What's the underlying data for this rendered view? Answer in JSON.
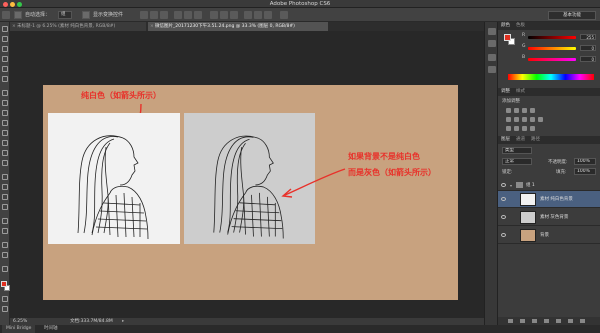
{
  "window": {
    "app_title": "Adobe Photoshop CS6",
    "workspace": "基本功能"
  },
  "options_bar": {
    "auto_select": "自动选择：",
    "auto_select_value": "组",
    "show_transform": "显示变换控件"
  },
  "tabs": [
    {
      "label": "未标题-1 @ 6.25% (素材 纯白色背景, RGB/8#)",
      "active": false
    },
    {
      "label": "微信图片_20171230下午3.51.24.png @ 33.3% (图层 0, RGB/8#)",
      "active": true
    }
  ],
  "canvas": {
    "annotation_top": "纯白色（如箭头所示）",
    "annotation_right_line1": "如果背景不是纯白色",
    "annotation_right_line2": "而是灰色（如箭头所示）",
    "doc_bg": "#c8a27f",
    "annotation_color": "#e8312a"
  },
  "status": {
    "zoom": "6.25%",
    "doc_size": "文档:333.7M/84.8M"
  },
  "mini_bridge": {
    "tab1": "Mini Bridge",
    "tab2": "时间轴"
  },
  "color_panel": {
    "tab1": "颜色",
    "tab2": "色板",
    "r_label": "R",
    "r_value": "255",
    "g_label": "G",
    "g_value": "0",
    "b_label": "B",
    "b_value": "0"
  },
  "adjust_panel": {
    "tab1": "调整",
    "tab2": "样式",
    "title": "添加调整"
  },
  "layers_panel": {
    "tab1": "图层",
    "tab2": "通道",
    "tab3": "路径",
    "kind": "类型",
    "blend_mode": "正常",
    "opacity_label": "不透明度:",
    "opacity": "100%",
    "lock_label": "锁定:",
    "fill_label": "填充:",
    "fill": "100%",
    "layers": [
      {
        "name": "组 1",
        "thumb": "",
        "selected": false
      },
      {
        "name": "素材 纯白色背景",
        "thumb": "#f2f2f2",
        "selected": true
      },
      {
        "name": "素材 灰色背景",
        "thumb": "#cdcdcd",
        "selected": false
      },
      {
        "name": "背景",
        "thumb": "#c8a27f",
        "selected": false
      }
    ]
  }
}
